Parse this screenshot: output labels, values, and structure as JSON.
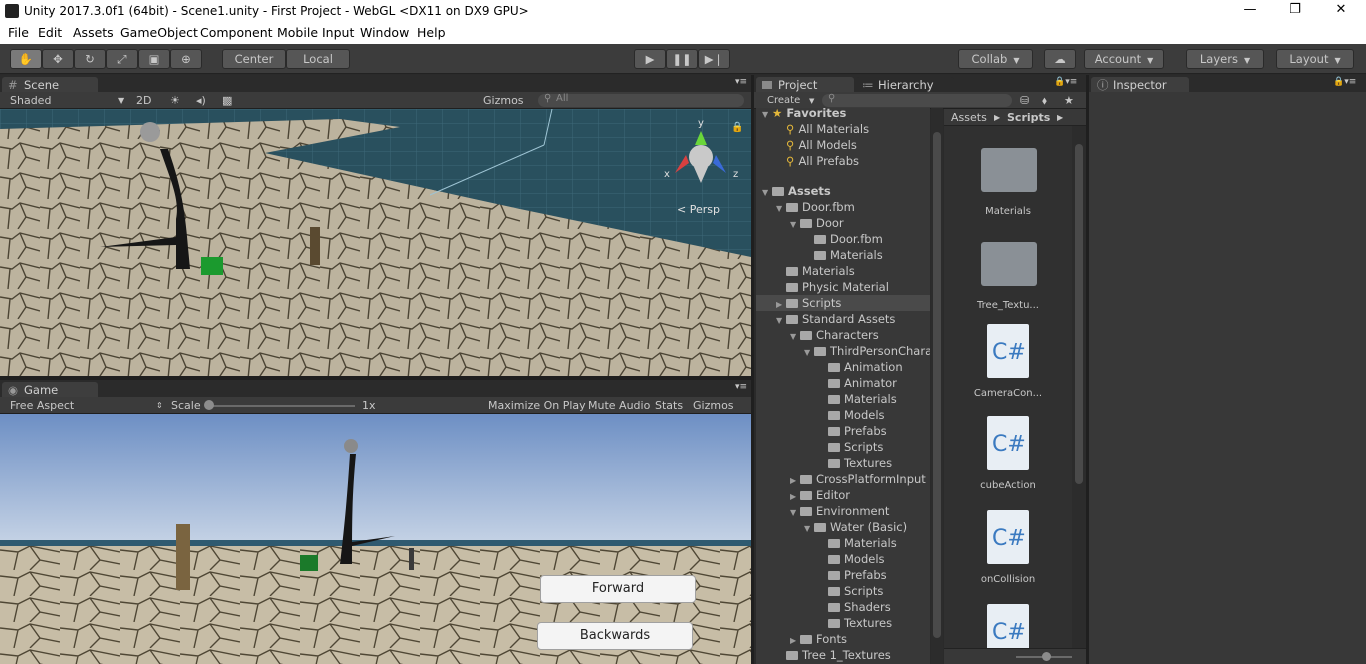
{
  "window": {
    "title": "Unity 2017.3.0f1 (64bit) - Scene1.unity - First Project - WebGL <DX11 on DX9 GPU>",
    "minimize": "—",
    "maximize": "❐",
    "close": "✕"
  },
  "menu": [
    "File",
    "Edit",
    "Assets",
    "GameObject",
    "Component",
    "Mobile Input",
    "Window",
    "Help"
  ],
  "toolbar": {
    "pivot": "Center",
    "space": "Local",
    "collab": "Collab",
    "account": "Account",
    "layers": "Layers",
    "layout": "Layout"
  },
  "scene": {
    "tab": "Scene",
    "shading": "Shaded",
    "mode2d": "2D",
    "gizmos": "Gizmos",
    "search_placeholder": "All",
    "persp": "Persp",
    "axis_y": "y",
    "axis_x": "x",
    "axis_z": "z"
  },
  "game": {
    "tab": "Game",
    "aspect": "Free Aspect",
    "scale_label": "Scale",
    "scale_value": "1x",
    "maximize": "Maximize On Play",
    "mute": "Mute Audio",
    "stats": "Stats",
    "gizmos": "Gizmos",
    "btn_forward": "Forward",
    "btn_backwards": "Backwards"
  },
  "project": {
    "tab_project": "Project",
    "tab_hierarchy": "Hierarchy",
    "create": "Create",
    "breadcrumb_root": "Assets",
    "breadcrumb_current": "Scripts",
    "tree": [
      {
        "label": "Favorites",
        "depth": 0,
        "kind": "fav-header"
      },
      {
        "label": "All Materials",
        "depth": 1,
        "kind": "search"
      },
      {
        "label": "All Models",
        "depth": 1,
        "kind": "search"
      },
      {
        "label": "All Prefabs",
        "depth": 1,
        "kind": "search"
      },
      {
        "label": "Assets",
        "depth": 0,
        "kind": "root"
      },
      {
        "label": "Door.fbm",
        "depth": 1,
        "kind": "open"
      },
      {
        "label": "Door",
        "depth": 2,
        "kind": "open"
      },
      {
        "label": "Door.fbm",
        "depth": 3,
        "kind": "leaf"
      },
      {
        "label": "Materials",
        "depth": 3,
        "kind": "leaf"
      },
      {
        "label": "Materials",
        "depth": 1,
        "kind": "leaf"
      },
      {
        "label": "Physic Material",
        "depth": 1,
        "kind": "leaf"
      },
      {
        "label": "Scripts",
        "depth": 1,
        "kind": "closed",
        "selected": true
      },
      {
        "label": "Standard Assets",
        "depth": 1,
        "kind": "open"
      },
      {
        "label": "Characters",
        "depth": 2,
        "kind": "open"
      },
      {
        "label": "ThirdPersonChara",
        "depth": 3,
        "kind": "open"
      },
      {
        "label": "Animation",
        "depth": 4,
        "kind": "leaf"
      },
      {
        "label": "Animator",
        "depth": 4,
        "kind": "leaf"
      },
      {
        "label": "Materials",
        "depth": 4,
        "kind": "leaf"
      },
      {
        "label": "Models",
        "depth": 4,
        "kind": "leaf"
      },
      {
        "label": "Prefabs",
        "depth": 4,
        "kind": "leaf"
      },
      {
        "label": "Scripts",
        "depth": 4,
        "kind": "leaf"
      },
      {
        "label": "Textures",
        "depth": 4,
        "kind": "leaf"
      },
      {
        "label": "CrossPlatformInput",
        "depth": 2,
        "kind": "closed"
      },
      {
        "label": "Editor",
        "depth": 2,
        "kind": "closed"
      },
      {
        "label": "Environment",
        "depth": 2,
        "kind": "open"
      },
      {
        "label": "Water (Basic)",
        "depth": 3,
        "kind": "open"
      },
      {
        "label": "Materials",
        "depth": 4,
        "kind": "leaf"
      },
      {
        "label": "Models",
        "depth": 4,
        "kind": "leaf"
      },
      {
        "label": "Prefabs",
        "depth": 4,
        "kind": "leaf"
      },
      {
        "label": "Scripts",
        "depth": 4,
        "kind": "leaf"
      },
      {
        "label": "Shaders",
        "depth": 4,
        "kind": "leaf"
      },
      {
        "label": "Textures",
        "depth": 4,
        "kind": "leaf"
      },
      {
        "label": "Fonts",
        "depth": 2,
        "kind": "closed"
      },
      {
        "label": "Tree 1_Textures",
        "depth": 1,
        "kind": "leaf"
      }
    ],
    "assets": [
      {
        "label": "Materials",
        "type": "folder"
      },
      {
        "label": "Tree_Textu...",
        "type": "folder"
      },
      {
        "label": "CameraCon...",
        "type": "script"
      },
      {
        "label": "cubeAction",
        "type": "script"
      },
      {
        "label": "onCollision",
        "type": "script"
      },
      {
        "label": "",
        "type": "script"
      }
    ]
  },
  "inspector": {
    "tab": "Inspector"
  }
}
